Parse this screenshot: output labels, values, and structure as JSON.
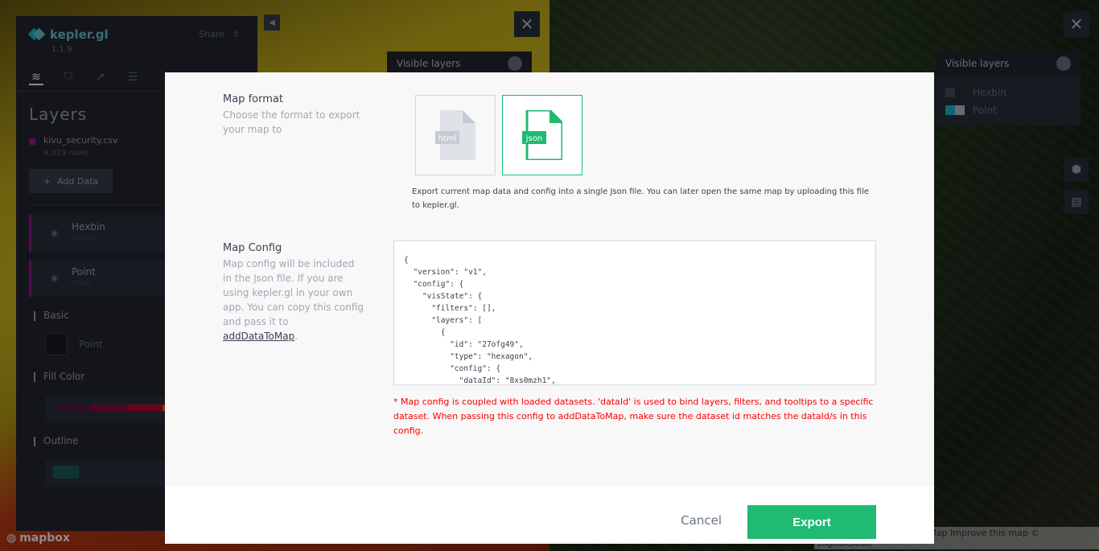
{
  "app": {
    "name": "kepler.gl",
    "version": "1.1.9",
    "share_label": "Share"
  },
  "sidepanel": {
    "title": "Layers",
    "dataset": {
      "name": "kivu_security.csv",
      "rows": "4,019 rows"
    },
    "add_data_label": "Add Data",
    "layers": [
      {
        "name": "Hexbin",
        "type": "Hexbin"
      },
      {
        "name": "Point",
        "type": "Point"
      }
    ],
    "sections": {
      "basic": "Basic",
      "fill_color": "Fill Color",
      "outline": "Outline"
    },
    "basic_type": "Point",
    "mapbox_label": "mapbox"
  },
  "map_left": {
    "legend_title": "Visible layers"
  },
  "map_right": {
    "legend_title": "Visible layers",
    "legend_items": [
      {
        "name": "Hexbin"
      },
      {
        "name": "Point"
      }
    ],
    "attribution": "© Mapbox © OpenStreetMap  Improve this map © DigitalGlobe"
  },
  "modal": {
    "map_format": {
      "title": "Map format",
      "description": "Choose the format to export your map to",
      "options": [
        {
          "label": "html",
          "selected": false
        },
        {
          "label": "json",
          "selected": true
        }
      ],
      "help": "Export current map data and config into a single Json file. You can later open the same map by uploading this file to kepler.gl."
    },
    "map_config": {
      "title": "Map Config",
      "description": "Map config will be included in the Json file. If you are using kepler.gl in your own app. You can copy this config and pass it to",
      "link": "addDataToMap",
      "link_suffix": ".",
      "code": "{\n  \"version\": \"v1\",\n  \"config\": {\n    \"visState\": {\n      \"filters\": [],\n      \"layers\": [\n        {\n          \"id\": \"27ofg49\",\n          \"type\": \"hexagon\",\n          \"config\": {\n            \"dataId\": \"8xs0mzh1\",",
      "warning": "* Map config is coupled with loaded datasets. 'dataId' is used to bind layers, filters, and tooltips to a specific dataset. When passing this config to addDataToMap, make sure the dataset id matches the dataId/s in this config."
    },
    "footer": {
      "cancel": "Cancel",
      "export": "Export"
    }
  },
  "colors": {
    "accent": "#1fbb72",
    "warning": "#f70000",
    "panel": "#242730"
  }
}
